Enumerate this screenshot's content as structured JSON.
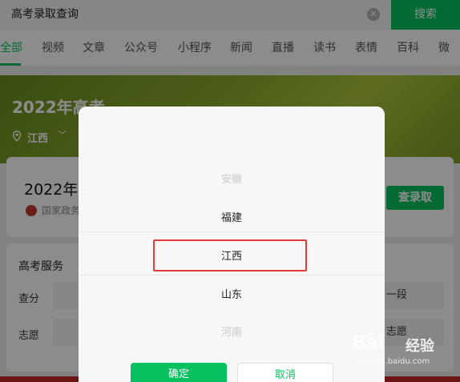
{
  "search": {
    "value": "高考录取查询",
    "button_label": "搜索"
  },
  "tabs": [
    "全部",
    "视频",
    "文章",
    "公众号",
    "小程序",
    "新闻",
    "直播",
    "读书",
    "表情",
    "百科",
    "微"
  ],
  "banner": {
    "title": "2022年高考",
    "location": "江西"
  },
  "card1": {
    "title": "2022年",
    "source": "国家政务",
    "button_label": "查录取"
  },
  "card2": {
    "title": "高考服务",
    "rows": [
      {
        "label": "查分",
        "right_item": "一段"
      },
      {
        "label": "志愿",
        "right_item": "志愿"
      }
    ]
  },
  "picker": {
    "options": [
      "安徽",
      "福建",
      "江西",
      "山东",
      "河南"
    ],
    "selected": "江西",
    "confirm_label": "确定",
    "cancel_label": "取消"
  },
  "watermark": {
    "brand": "Bai",
    "label": "经验",
    "url": "jingyan.baidu.com"
  }
}
